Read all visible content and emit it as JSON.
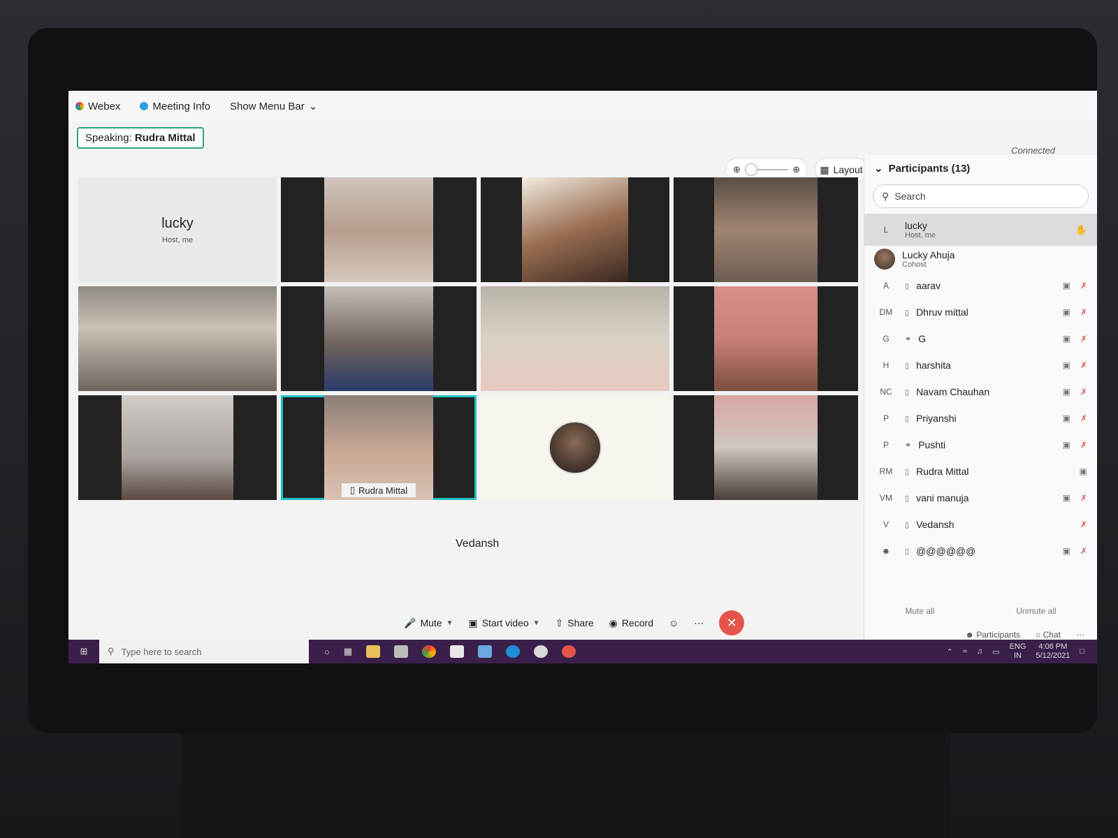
{
  "titlebar": {
    "app_name": "Webex",
    "meeting_info": "Meeting Info",
    "show_menu_bar": "Show Menu Bar"
  },
  "speaking": {
    "prefix": "Speaking:",
    "name": "Rudra Mittal"
  },
  "status": {
    "connected": "Connected"
  },
  "layout_button": "Layout",
  "tiles": {
    "host_tile": {
      "name": "lucky",
      "sub": "Host, me"
    },
    "active_label": "Rudra Mittal",
    "vedansh_label": "Vedansh"
  },
  "controls": {
    "mute": "Mute",
    "start_video": "Start video",
    "share": "Share",
    "record": "Record"
  },
  "panel": {
    "title": "Participants (13)",
    "search_placeholder": "Search",
    "participants": [
      {
        "initials": "L",
        "name": "lucky",
        "role": "Host, me"
      },
      {
        "initials": "",
        "name": "Lucky Ahuja",
        "role": "Cohost"
      },
      {
        "initials": "A",
        "name": "aarav",
        "role": ""
      },
      {
        "initials": "DM",
        "name": "Dhruv mittal",
        "role": ""
      },
      {
        "initials": "G",
        "name": "G",
        "role": ""
      },
      {
        "initials": "H",
        "name": "harshita",
        "role": ""
      },
      {
        "initials": "NC",
        "name": "Navam Chauhan",
        "role": ""
      },
      {
        "initials": "P",
        "name": "Priyanshi",
        "role": ""
      },
      {
        "initials": "P",
        "name": "Pushti",
        "role": ""
      },
      {
        "initials": "RM",
        "name": "Rudra Mittal",
        "role": ""
      },
      {
        "initials": "VM",
        "name": "vani manuja",
        "role": ""
      },
      {
        "initials": "V",
        "name": "Vedansh",
        "role": ""
      },
      {
        "initials": "",
        "name": "@@@@@@",
        "role": ""
      }
    ],
    "mute_all": "Mute all",
    "unmute_all": "Unmute all",
    "tab_participants": "Participants",
    "tab_chat": "Chat"
  },
  "taskbar": {
    "search_placeholder": "Type here to search",
    "lang": "ENG",
    "region": "IN",
    "time": "4:06 PM",
    "date": "5/12/2021"
  },
  "colors": {
    "accent": "#20c2c2",
    "speaking_border": "#2aa876",
    "end_call": "#e5534b",
    "taskbar": "#3a1f4a"
  }
}
